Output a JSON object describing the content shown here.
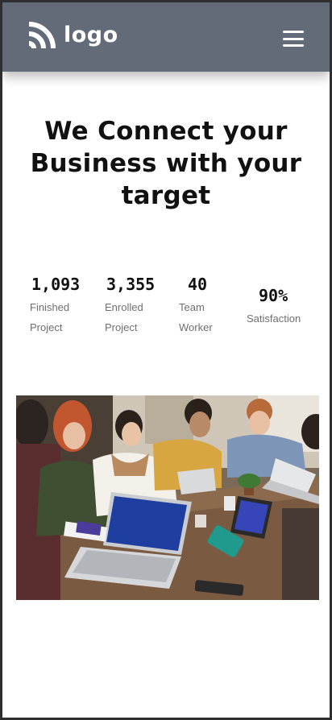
{
  "navbar": {
    "logo_text": "logo",
    "logo_icon": "wifi-arcs-icon",
    "menu_icon": "hamburger-menu-icon",
    "background_color": "#626b77"
  },
  "hero": {
    "title": "We Connect your Business with your target"
  },
  "stats": [
    {
      "value": "1,093",
      "label_line1": "Finished",
      "label_line2": "Project"
    },
    {
      "value": "3,355",
      "label_line1": "Enrolled",
      "label_line2": "Project"
    },
    {
      "value": "40",
      "label_line1": "Team",
      "label_line2": "Worker"
    },
    {
      "value": "90%",
      "label_line1": "Satisfaction",
      "label_line2": ""
    }
  ],
  "image": {
    "laptop_screen_text_1": "",
    "laptop_screen_text_2": ""
  }
}
